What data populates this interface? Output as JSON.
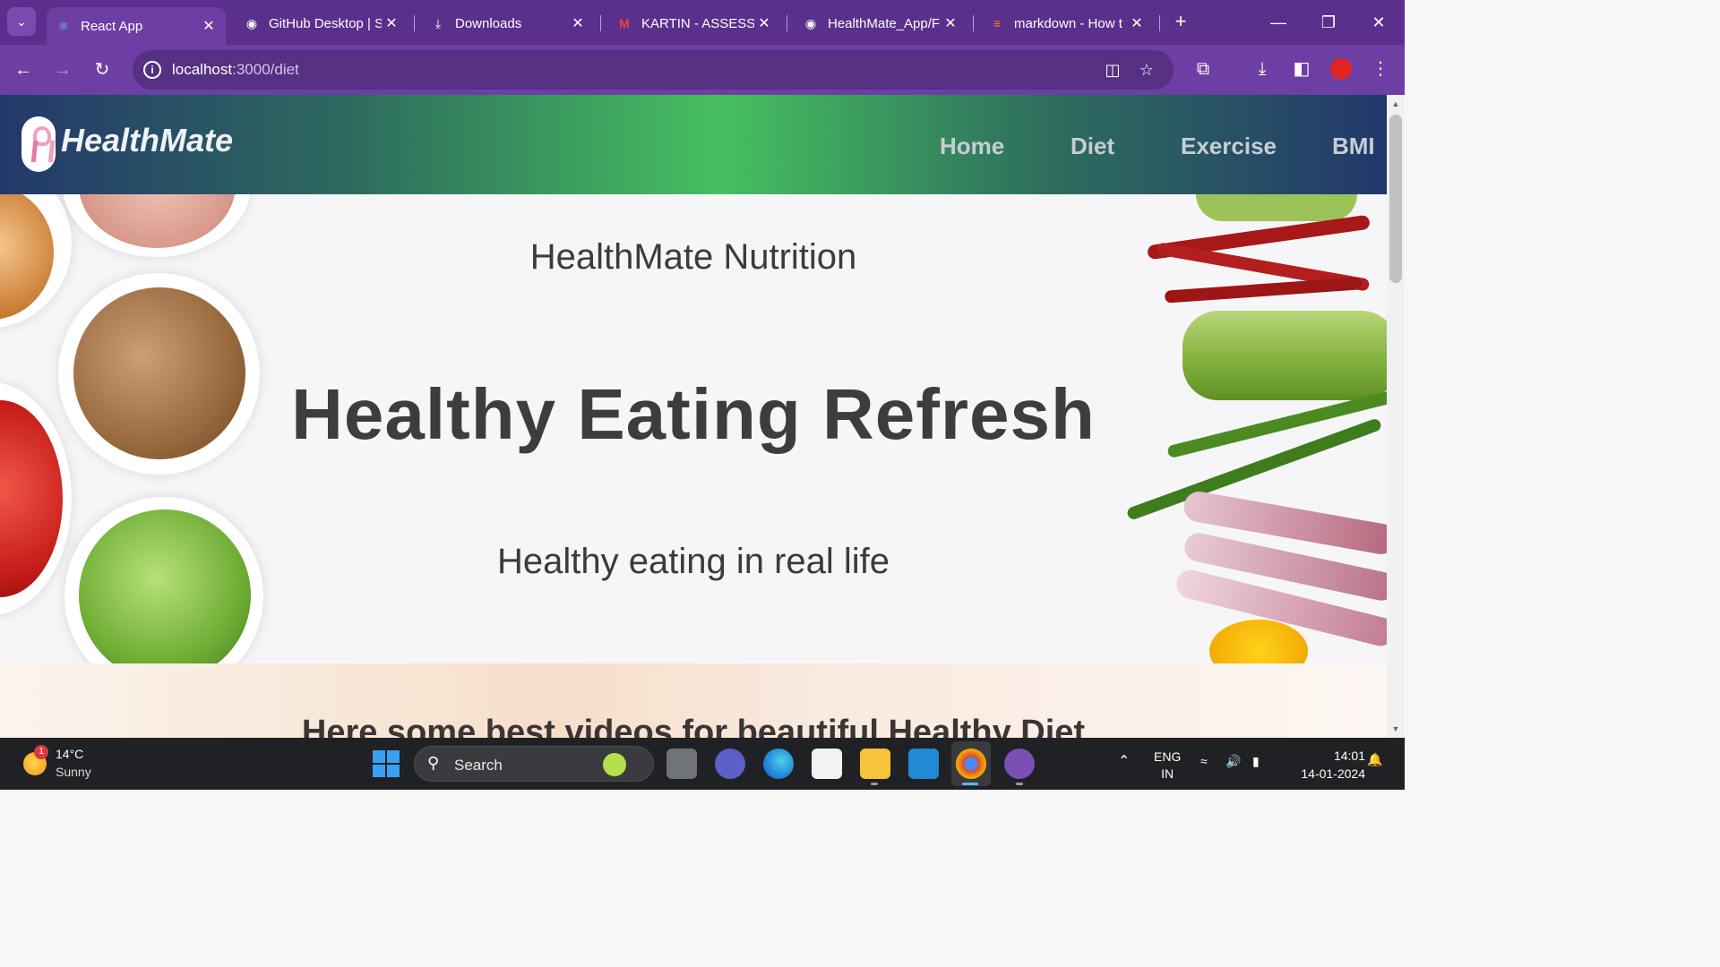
{
  "browser": {
    "tabs": [
      {
        "title": "React App",
        "icon": "react-icon",
        "active": true
      },
      {
        "title": "GitHub Desktop | S",
        "icon": "github-icon",
        "active": false
      },
      {
        "title": "Downloads",
        "icon": "download-icon",
        "active": false
      },
      {
        "title": "KARTIN - ASSESSM",
        "icon": "gmail-icon",
        "active": false
      },
      {
        "title": "HealthMate_App/F",
        "icon": "github-icon",
        "active": false
      },
      {
        "title": "markdown - How t",
        "icon": "stackoverflow-icon",
        "active": false
      }
    ],
    "url_host": "localhost",
    "url_path": ":3000/diet"
  },
  "site": {
    "brand": "HealthMate",
    "nav": [
      "Home",
      "Diet",
      "Exercise",
      "BMI"
    ]
  },
  "hero": {
    "subtitle": "HealthMate Nutrition",
    "title": "Healthy Eating Refresh",
    "tagline": "Healthy eating in real life"
  },
  "section2": {
    "title": "Here some best videos for beautiful Healthy Diet"
  },
  "taskbar": {
    "weather_temp": "14°C",
    "weather_desc": "Sunny",
    "weather_badge": "1",
    "search_label": "Search",
    "lang_top": "ENG",
    "lang_bottom": "IN",
    "time": "14:01",
    "date": "14-01-2024"
  },
  "colors": {
    "browser_frame": "#5b2f8c",
    "nav_gradient_mid": "#46c05f",
    "nav_gradient_edge": "#23386b",
    "hero_text": "#403b3d"
  }
}
